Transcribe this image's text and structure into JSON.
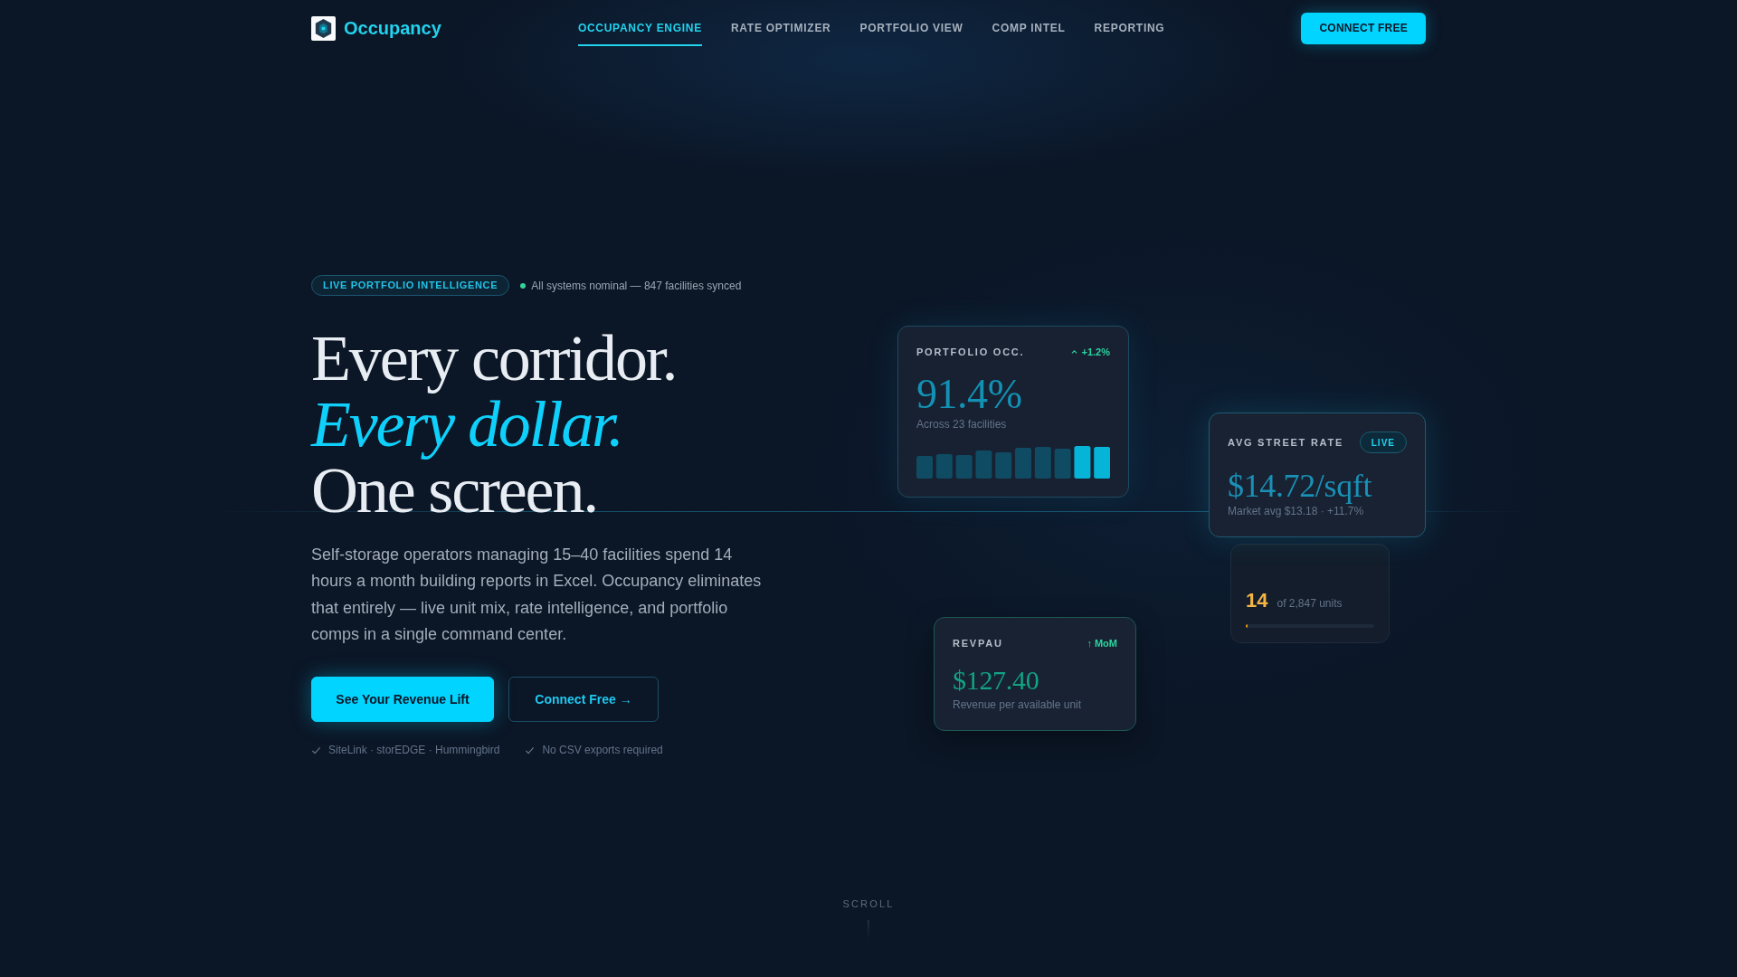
{
  "header": {
    "brand": "Occupancy",
    "nav": [
      {
        "label": "OCCUPANCY ENGINE",
        "selected": true
      },
      {
        "label": "RATE OPTIMIZER",
        "selected": false
      },
      {
        "label": "PORTFOLIO VIEW",
        "selected": false
      },
      {
        "label": "COMP INTEL",
        "selected": false
      },
      {
        "label": "REPORTING",
        "selected": false
      }
    ],
    "cta": "CONNECT FREE"
  },
  "hero": {
    "badge": "LIVE PORTFOLIO INTELLIGENCE",
    "status": "All systems nominal — 847 facilities synced",
    "headline": [
      {
        "text": "Every corridor.",
        "kind": "plain"
      },
      {
        "text": "Every dollar.",
        "kind": "accent"
      },
      {
        "text": "One screen.",
        "kind": "plain"
      }
    ],
    "description": "Self-storage operators managing 15–40 facilities spend 14 hours a month building reports in Excel. Occupancy eliminates that entirely — live unit mix, rate intelligence, and portfolio comps in a single command center.",
    "buttons": [
      {
        "label": "See Your Revenue Lift",
        "kind": "primary"
      },
      {
        "label": "Connect Free →",
        "kind": "outline"
      }
    ],
    "checks": [
      "SiteLink · storEDGE · Hummingbird",
      "No CSV exports required"
    ]
  },
  "cards": [
    {
      "kind": "occupancy",
      "label": "PORTFOLIO OCC.",
      "change": "+1.2%",
      "value": "91.4%",
      "caption": "Across 23 facilities"
    },
    {
      "kind": "rate",
      "label": "AVG STREET RATE",
      "badge": "LIVE",
      "value": "$14.72/sqft",
      "caption": "Market avg $13.18 · +11.7%"
    },
    {
      "kind": "risk",
      "value": "14",
      "caption": "of 2,847 units",
      "level": 0.014
    },
    {
      "kind": "revpau",
      "label": "REVPAU",
      "change": "↑ MoM",
      "value": "$127.40",
      "caption": "Revenue per available unit"
    }
  ],
  "scroll_hint": "SCROLL"
}
